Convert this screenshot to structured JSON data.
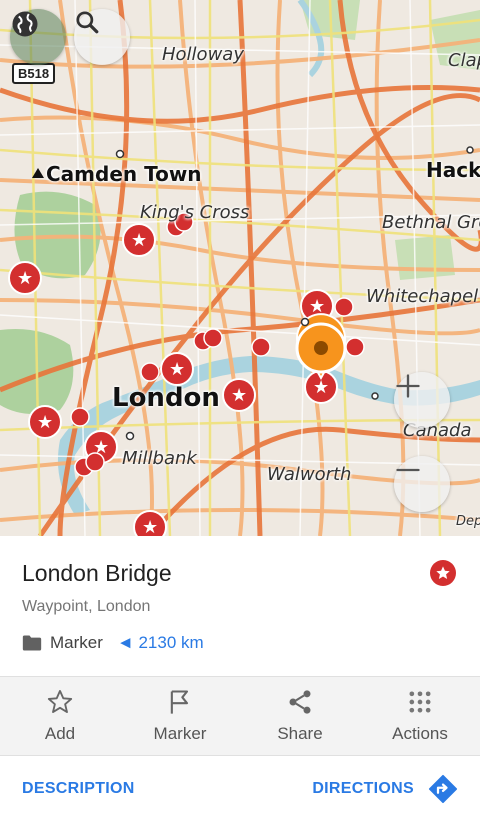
{
  "map": {
    "road_badge": "B518",
    "labels": {
      "holloway": "Holloway",
      "clapton": "Clap",
      "camden": "Camden Town",
      "hackney": "Hackr",
      "kings_cross": "King's Cross",
      "bethnal_green": "Bethnal Gre",
      "whitechapel": "Whitechapel",
      "london": "London",
      "canada": "Canada",
      "millbank": "Millbank",
      "walworth": "Walworth",
      "deptford": "Dep"
    },
    "icons": {
      "layers": "globe-icon",
      "search": "search-icon",
      "zoom_in": "plus-icon",
      "zoom_out": "minus-icon"
    }
  },
  "place": {
    "title": "London Bridge",
    "subtitle": "Waypoint, London",
    "folder": "Marker",
    "distance": "◄ 2130 km"
  },
  "actions": [
    {
      "label": "Add",
      "icon": "star-outline-icon"
    },
    {
      "label": "Marker",
      "icon": "flag-icon"
    },
    {
      "label": "Share",
      "icon": "share-icon"
    },
    {
      "label": "Actions",
      "icon": "grid-dots-icon"
    }
  ],
  "bottom": {
    "description": "DESCRIPTION",
    "directions": "DIRECTIONS"
  },
  "colors": {
    "accent": "#2a7ae4",
    "marker_red": "#d32f2f",
    "selected_pin": "#f7941d",
    "river": "#aad3df",
    "park": "#add19e"
  }
}
